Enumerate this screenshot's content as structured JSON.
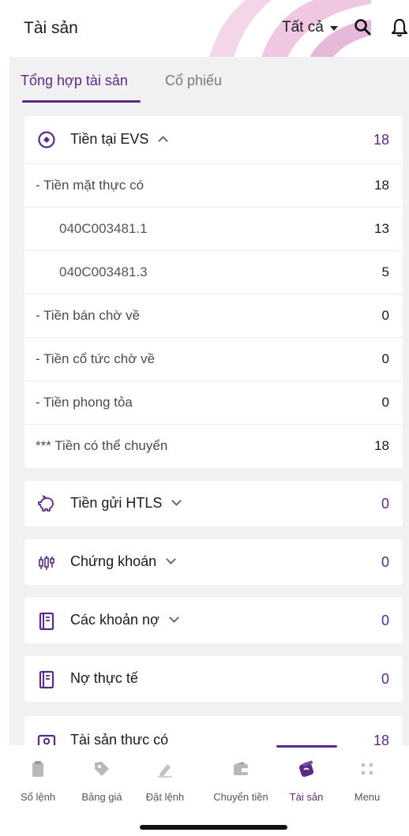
{
  "header": {
    "title": "Tài sản",
    "filter": "Tất cả",
    "icons": [
      "search-icon",
      "bell-icon"
    ],
    "accent": "#5b2a86"
  },
  "tabs": [
    {
      "label": "Tổng hợp tài sản",
      "active": true
    },
    {
      "label": "Cổ phiếu",
      "active": false
    }
  ],
  "cash_card": {
    "title": "Tiền tại EVS",
    "value": "18",
    "icon": "target-circle-icon",
    "expanded": true,
    "rows": [
      {
        "label": "- Tiền mặt thực có",
        "value": "18"
      },
      {
        "label": "040C003481.1",
        "value": "13"
      },
      {
        "label": "040C003481.3",
        "value": "5"
      },
      {
        "label": "- Tiền bán chờ về",
        "value": "0"
      },
      {
        "label": "- Tiền cổ tức chờ về",
        "value": "0"
      },
      {
        "label": "- Tiền phong tỏa",
        "value": "0"
      },
      {
        "label": "*** Tiền có thể chuyển",
        "value": "18"
      }
    ]
  },
  "cards": [
    {
      "title": "Tiền gửi HTLS",
      "value": "0",
      "icon": "piggy-bank-icon",
      "chevron": true
    },
    {
      "title": "Chứng khoán",
      "value": "0",
      "icon": "candlestick-icon",
      "chevron": true
    },
    {
      "title": "Các khoản nợ",
      "value": "0",
      "icon": "ledger-icon",
      "chevron": true
    },
    {
      "title": "Nợ thực tế",
      "value": "0",
      "icon": "ledger-icon",
      "chevron": false
    },
    {
      "title": "Tài sản thực có",
      "value": "18",
      "icon": "cash-icon",
      "chevron": false
    }
  ],
  "bottom_nav": [
    {
      "label": "Sổ lệnh",
      "icon": "clipboard-icon",
      "active": false
    },
    {
      "label": "Bảng giá",
      "icon": "tag-icon",
      "active": false
    },
    {
      "label": "Đặt lệnh",
      "icon": "pen-icon",
      "active": false
    },
    {
      "label": "Chuyển tiền",
      "icon": "wallet-icon",
      "active": false
    },
    {
      "label": "Tài sản",
      "icon": "assets-icon",
      "active": true
    },
    {
      "label": "Menu",
      "icon": "dots-icon",
      "active": false
    }
  ]
}
